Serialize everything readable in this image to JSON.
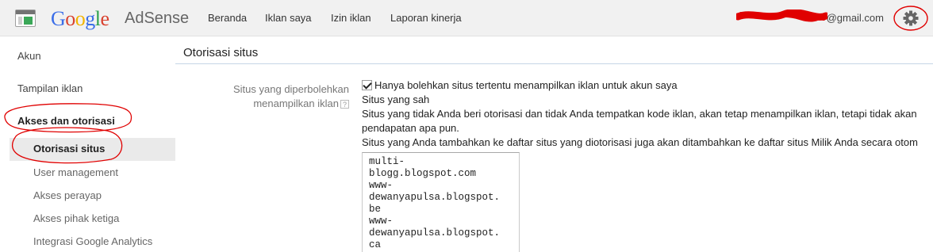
{
  "header": {
    "logo_google": [
      "G",
      "o",
      "o",
      "g",
      "l",
      "e"
    ],
    "product": "AdSense",
    "nav": [
      "Beranda",
      "Iklan saya",
      "Izin iklan",
      "Laporan kinerja"
    ],
    "account_email": "@gmail.com",
    "settings_icon": "gear-icon",
    "app_icon": "adsense-app-icon"
  },
  "sidebar": {
    "items": [
      {
        "label": "Akun"
      },
      {
        "label": "Tampilan iklan"
      },
      {
        "label": "Akses dan otorisasi"
      }
    ],
    "subitems": [
      {
        "label": "Otorisasi situs",
        "active": true
      },
      {
        "label": "User management"
      },
      {
        "label": "Akses perayap"
      },
      {
        "label": "Akses pihak ketiga"
      },
      {
        "label": "Integrasi Google Analytics"
      }
    ]
  },
  "main": {
    "title": "Otorisasi situs",
    "field_label_line1": "Situs yang diperbolehkan",
    "field_label_line2": "menampilkan iklan",
    "help_glyph": "?",
    "checkbox_label": "Hanya bolehkan situs tertentu menampilkan iklan untuk akun saya",
    "checkbox_checked": true,
    "subheading": "Situs yang sah",
    "paragraph1_line1": "Situs yang tidak Anda beri otorisasi dan tidak Anda tempatkan kode iklan, akan tetap menampilkan iklan, tetapi tidak akan",
    "paragraph1_line2": "pendapatan apa pun.",
    "paragraph2": "Situs yang Anda tambahkan ke daftar situs yang diotorisasi juga akan ditambahkan ke daftar situs Milik Anda secara otom",
    "sites_lines": [
      "multi-",
      "blogg.blogspot.com",
      "www-",
      "dewanyapulsa.blogspot.",
      "be",
      "www-",
      "dewanyapulsa.blogspot.",
      "ca"
    ]
  },
  "colors": {
    "annotation_red": "#e00000",
    "header_bg": "#f1f1f1",
    "active_item_bg": "#eaeaea"
  }
}
